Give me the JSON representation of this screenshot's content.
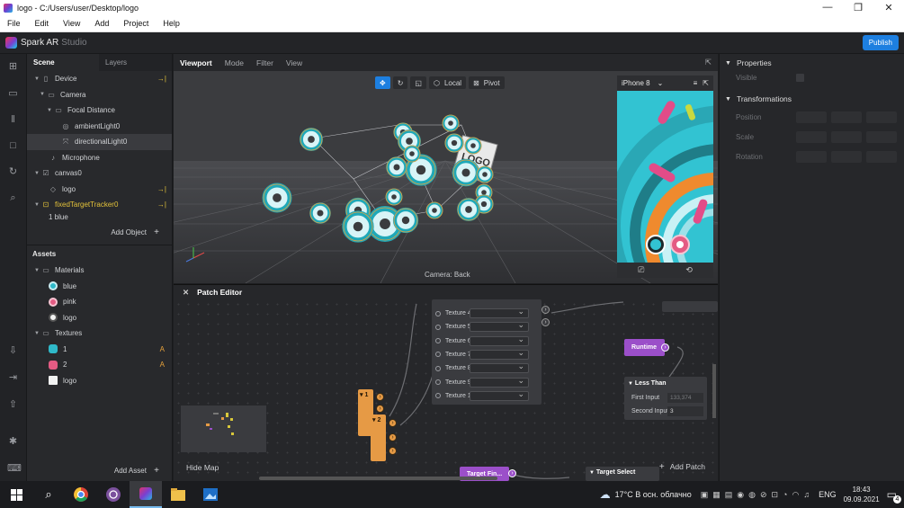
{
  "window": {
    "title": "logo - C:/Users/user/Desktop/logo",
    "buttons": [
      "—",
      "❐",
      "✕"
    ]
  },
  "menu": [
    "File",
    "Edit",
    "View",
    "Add",
    "Project",
    "Help"
  ],
  "app": {
    "name": "Spark AR",
    "sub": "Studio",
    "publish": "Publish"
  },
  "scene": {
    "tabs": [
      "Scene",
      "Layers"
    ],
    "items": [
      {
        "label": "Device",
        "indent": 0
      },
      {
        "label": "Camera",
        "indent": 1
      },
      {
        "label": "Focal Distance",
        "indent": 2
      },
      {
        "label": "ambientLight0",
        "indent": 3
      },
      {
        "label": "directionalLight0",
        "indent": 3
      },
      {
        "label": "Microphone",
        "indent": 1
      },
      {
        "label": "canvas0",
        "indent": 0
      },
      {
        "label": "logo",
        "indent": 1
      },
      {
        "label": "fixedTargetTracker0",
        "indent": 0
      },
      {
        "label": "1 blue",
        "indent": 1
      }
    ],
    "add_object": "Add Object"
  },
  "assets": {
    "title": "Assets",
    "materials_label": "Materials",
    "materials": [
      {
        "label": "blue",
        "color": "#2fb9c9"
      },
      {
        "label": "pink",
        "color": "#e45b83"
      },
      {
        "label": "logo",
        "color": "#f2f2f2"
      }
    ],
    "textures_label": "Textures",
    "textures": [
      {
        "label": "1",
        "badge": "A"
      },
      {
        "label": "2",
        "badge": "A"
      },
      {
        "label": "logo",
        "badge": ""
      }
    ],
    "add_asset": "Add Asset"
  },
  "viewport": {
    "tabs": [
      "Viewport",
      "Mode",
      "Filter",
      "View"
    ],
    "local": "Local",
    "pivot": "Pivot",
    "camera_label": "Camera: Back",
    "logo_text": "LOGO"
  },
  "preview": {
    "device": "iPhone 8"
  },
  "properties": {
    "title": "Properties",
    "visible": "Visible",
    "transformations": "Transformations",
    "position": "Position",
    "scale": "Scale",
    "rotation": "Rotation"
  },
  "patch": {
    "title": "Patch Editor",
    "textures": [
      "Texture 4",
      "Texture 5",
      "Texture 6",
      "Texture 7",
      "Texture 8",
      "Texture 9",
      "Texture 10"
    ],
    "runtime": "Runtime",
    "less_than": "Less Than",
    "first_input": "First Input",
    "first_value": "133,374",
    "second_input": "Second Input",
    "second_value": "3",
    "target_find": "Target Fin...",
    "target_select": "Target Select",
    "node1": "1",
    "node2": "2",
    "hide_map": "Hide Map",
    "add_patch": "Add Patch"
  },
  "taskbar": {
    "weather": "17°C  В осн. облачно",
    "lang": "ENG",
    "time": "18:43",
    "date": "09.09.2021",
    "notif": "4"
  }
}
